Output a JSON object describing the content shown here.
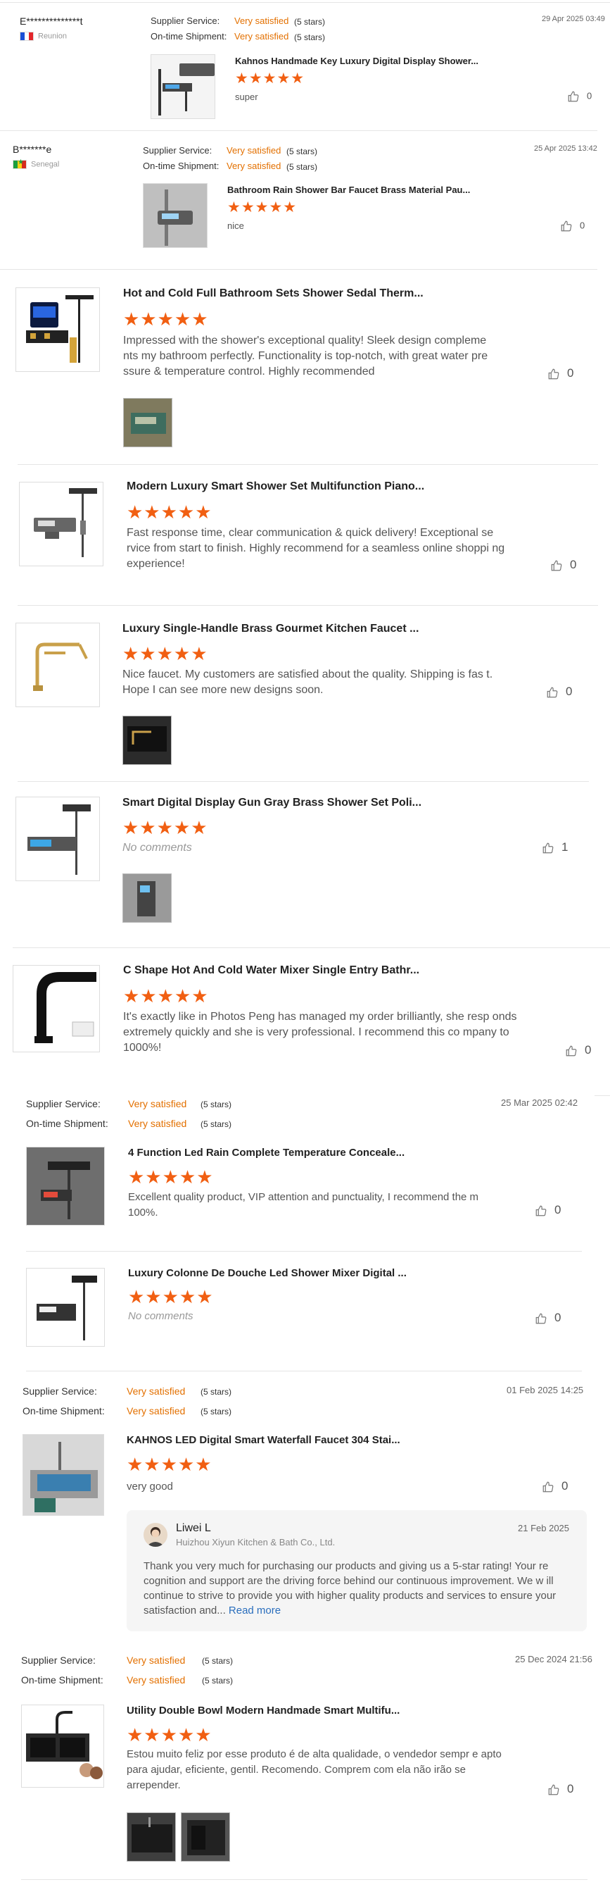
{
  "reviews": [
    {
      "name": "E**************t",
      "country": "Reunion",
      "supplier_label": "Supplier Service:",
      "supplier_value": "Very satisfied",
      "supplier_stars": "(5 stars)",
      "shipment_label": "On-time Shipment:",
      "shipment_value": "Very satisfied",
      "shipment_stars": "(5 stars)",
      "date": "29 Apr 2025 03:49",
      "product": "Kahnos Handmade Key Luxury Digital Display Shower...",
      "text": "super",
      "likes": "0"
    },
    {
      "name": "B*******e",
      "country": "Senegal",
      "supplier_label": "Supplier Service:",
      "supplier_value": "Very satisfied",
      "supplier_stars": "(5 stars)",
      "shipment_label": "On-time Shipment:",
      "shipment_value": "Very satisfied",
      "shipment_stars": "(5 stars)",
      "date": "25 Apr 2025 13:42",
      "product": "Bathroom Rain Shower Bar Faucet Brass Material Pau...",
      "text": "nice",
      "likes": "0"
    },
    {
      "product": "Hot and Cold Full Bathroom Sets Shower Sedal Therm...",
      "text": "Impressed with the shower's exceptional quality! Sleek design compleme nts my bathroom perfectly. Functionality is top-notch, with great water pre ssure & temperature control. Highly recommended",
      "likes": "0"
    },
    {
      "product": "Modern Luxury Smart Shower Set Multifunction Piano...",
      "text": "Fast response time, clear communication & quick delivery! Exceptional se rvice from start to finish. Highly recommend for a seamless online shoppi ng experience!",
      "likes": "0"
    },
    {
      "product": "Luxury Single-Handle Brass Gourmet Kitchen Faucet ...",
      "text": "Nice faucet. My customers are satisfied about the quality. Shipping is fas t. Hope I can see more new designs soon.",
      "likes": "0"
    },
    {
      "product": "Smart Digital Display Gun Gray Brass Shower Set Poli...",
      "text": "No comments",
      "likes": "1"
    },
    {
      "product": "C Shape Hot And Cold Water Mixer Single Entry Bathr...",
      "text": "It's exactly like in Photos Peng has managed my order brilliantly, she resp onds extremely quickly and she is very professional. I recommend this co mpany to 1000%!",
      "likes": "0"
    },
    {
      "supplier_label": "Supplier Service:",
      "supplier_value": "Very satisfied",
      "supplier_stars": "(5 stars)",
      "shipment_label": "On-time Shipment:",
      "shipment_value": "Very satisfied",
      "shipment_stars": "(5 stars)",
      "date": "25 Mar 2025 02:42",
      "product": "4 Function Led Rain Complete Temperature Conceale...",
      "text": "Excellent quality product, VIP attention and punctuality, I recommend the m 100%.",
      "likes": "0"
    },
    {
      "product": "Luxury Colonne De Douche Led Shower Mixer Digital ...",
      "text": "No comments",
      "likes": "0"
    },
    {
      "supplier_label": "Supplier Service:",
      "supplier_value": "Very satisfied",
      "supplier_stars": "(5 stars)",
      "shipment_label": "On-time Shipment:",
      "shipment_value": "Very satisfied",
      "shipment_stars": "(5 stars)",
      "date": "01 Feb 2025 14:25",
      "product": "KAHNOS LED Digital Smart Waterfall Faucet 304 Stai...",
      "text": "very good",
      "likes": "0",
      "reply": {
        "name": "Liwei L",
        "company": "Huizhou Xiyun Kitchen & Bath Co., Ltd.",
        "date": "21 Feb 2025",
        "text": "Thank you very much for purchasing our products and giving us a 5-star rating! Your re cognition and support are the driving force behind our continuous improvement. We w ill continue to strive to provide you with higher quality products and services to ensure your satisfaction and...",
        "read_more": "Read more"
      }
    },
    {
      "supplier_label": "Supplier Service:",
      "supplier_value": "Very satisfied",
      "supplier_stars": "(5 stars)",
      "shipment_label": "On-time Shipment:",
      "shipment_value": "Very satisfied",
      "shipment_stars": "(5 stars)",
      "date": "25 Dec 2024 21:56",
      "product": "Utility Double Bowl Modern Handmade Smart Multifu...",
      "text": "Estou muito feliz por esse produto é de alta qualidade,  o vendedor sempr e apto para ajudar,  eficiente,  gentil.  Recomendo. Comprem com ela não irão se arrepender.",
      "likes": "0"
    }
  ],
  "stars_display": "★★★★★",
  "colors": {
    "accent": "#f15f12",
    "rating_text": "#e37000",
    "link": "#2a6ebd"
  },
  "icons": {
    "like": "thumbs-up-icon"
  }
}
